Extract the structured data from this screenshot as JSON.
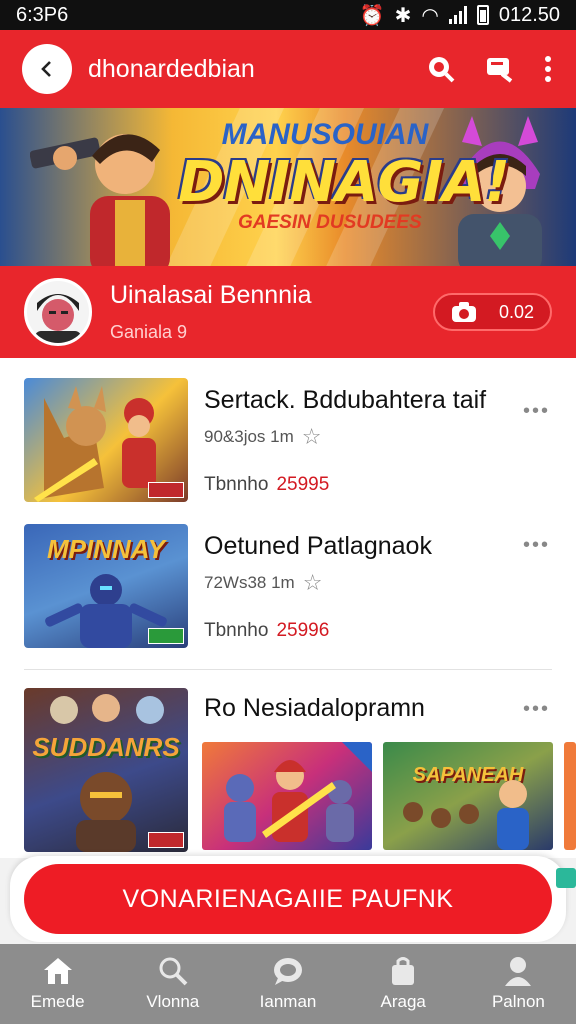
{
  "status_bar": {
    "time": "6:3P6",
    "right_text": "012.50"
  },
  "app_bar": {
    "title": "dhonardedbian",
    "icons": [
      "back-arrow-icon",
      "search-icon",
      "cast-icon",
      "more-vert-icon"
    ]
  },
  "banner": {
    "top_text": "MANUSOUIAN",
    "title": "DNINAGIA!",
    "subtitle": "GAESIN DUSUDEES"
  },
  "profile": {
    "name": "Uinalasai Bennnia",
    "subtitle": "Ganiala 9",
    "pill_value": "0.02"
  },
  "items": [
    {
      "title": "Sertack. Bddubahtera taif",
      "meta": "90&3jos 1m",
      "price_label": "Tbnnho",
      "price_value": "25995",
      "thumb_text": ""
    },
    {
      "title": "Oetuned Patlagnaok",
      "meta": "72Ws38 1m",
      "price_label": "Tbnnho",
      "price_value": "25996",
      "thumb_text": "MPINNAY"
    },
    {
      "title": "Ro Nesiadalopramn",
      "meta": "",
      "price_label": "",
      "price_value": "",
      "thumb_text": "SUDDANRS",
      "mini_texts": [
        "",
        "SAPANEAH",
        ""
      ]
    }
  ],
  "cta": {
    "label": "VONARIENAGAIIE PAUFNK"
  },
  "bottom_nav": [
    {
      "label": "Emede",
      "icon": "home-icon"
    },
    {
      "label": "Vlonna",
      "icon": "search-icon"
    },
    {
      "label": "Ianman",
      "icon": "chat-icon"
    },
    {
      "label": "Araga",
      "icon": "bag-icon"
    },
    {
      "label": "Palnon",
      "icon": "person-icon"
    }
  ],
  "colors": {
    "primary": "#e8262c",
    "cta": "#ee1c25",
    "nav": "#8d8d8d",
    "price": "#d31a22"
  }
}
